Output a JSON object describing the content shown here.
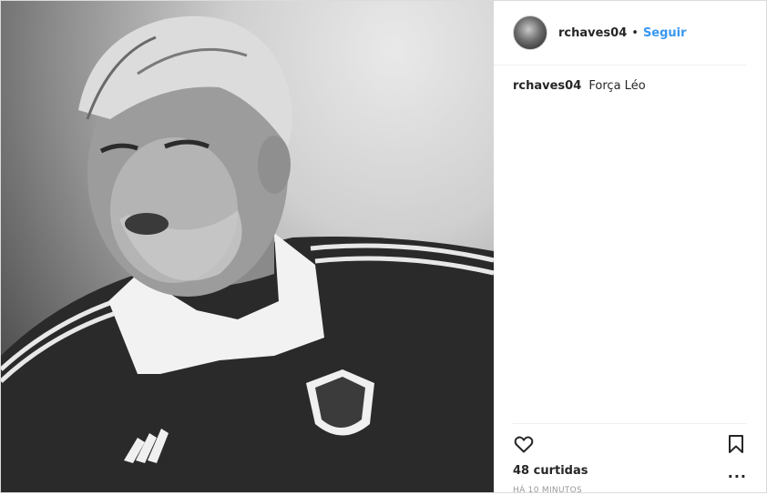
{
  "post": {
    "author": {
      "username": "rchaves04",
      "follow_label": "Seguir",
      "separator": "•"
    },
    "caption": {
      "username": "rchaves04",
      "text": "Força Léo"
    },
    "likes": "48 curtidas",
    "timestamp": "HÁ 10 MINUTOS",
    "icons": {
      "like": "heart-icon",
      "save": "bookmark-icon",
      "more": "more-options-icon"
    },
    "more_label": "...",
    "colors": {
      "follow": "#3897f0",
      "text": "#262626",
      "muted": "#999999",
      "border": "#efefef"
    }
  }
}
